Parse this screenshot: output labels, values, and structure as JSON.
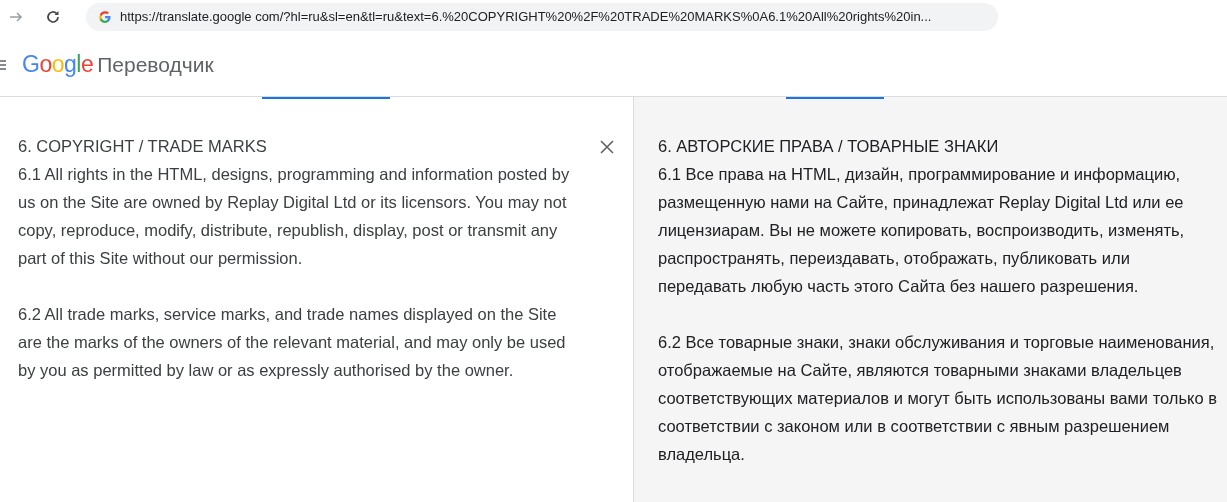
{
  "browser": {
    "url": "https://translate.google com/?hl=ru&sl=en&tl=ru&text=6.%20COPYRIGHT%20%2F%20TRADE%20MARKS%0A6.1%20All%20rights%20in..."
  },
  "header": {
    "logo": "Google",
    "product": "Переводчик"
  },
  "source": {
    "paragraphs": [
      "6. COPYRIGHT / TRADE MARKS\n6.1 All rights in the HTML, designs, programming and information posted by us on the Site are owned by Replay Digital Ltd or its licensors. You may not copy, reproduce, modify, distribute, republish, display, post or transmit any part of this Site without our permission.",
      "6.2 All trade marks, service marks, and trade names displayed on the Site are the marks of the owners of the relevant material, and may only be used by you as permitted by law or as expressly authorised by the owner."
    ]
  },
  "translation": {
    "paragraphs": [
      "6. АВТОРСКИЕ ПРАВА / ТОВАРНЫЕ ЗНАКИ\n6.1 Все права на HTML, дизайн, программирование и информацию, размещенную нами на Сайте, принадлежат Replay Digital Ltd или ее лицензиарам. Вы не можете копировать, воспроизводить, изменять, распространять, переиздавать, отображать, публиковать или передавать любую часть этого Сайта без нашего разрешения.",
      "6.2 Все товарные знаки, знаки обслуживания и торговые наименования, отображаемые на Сайте, являются товарными знаками владельцев соответствующих материалов и могут быть использованы вами только в соответствии с законом или в соответствии с явным разрешением владельца."
    ]
  }
}
